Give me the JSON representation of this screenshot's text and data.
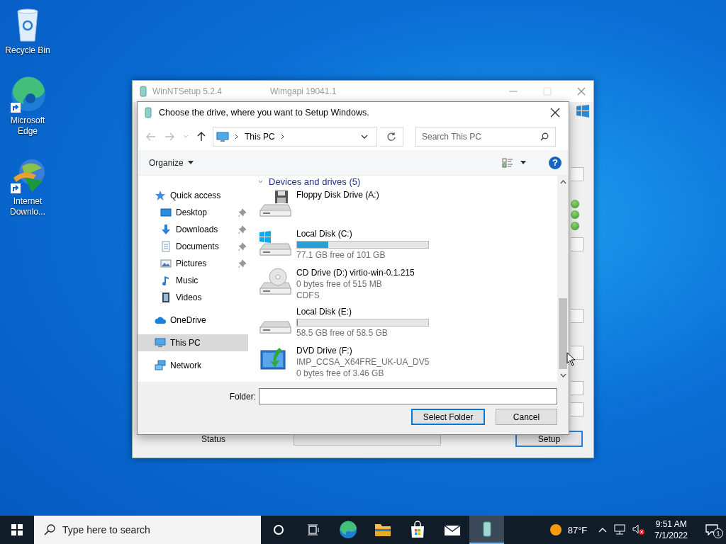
{
  "desktop_icons": [
    {
      "label": "Recycle Bin",
      "kind": "recycle"
    },
    {
      "label": "Microsoft Edge",
      "kind": "edge"
    },
    {
      "label": "Internet Downlo...",
      "kind": "idm"
    }
  ],
  "background_window": {
    "title": "WinNTSetup 5.2.4",
    "subtitle": "Wimgapi 19041.1",
    "status_label": "Status",
    "setup_button": "Setup"
  },
  "dialog": {
    "title": "Choose the drive, where you want to Setup Windows.",
    "nav_buttons": [
      {
        "kind": "back",
        "disabled": true
      },
      {
        "kind": "forward",
        "disabled": true
      },
      {
        "kind": "recent",
        "disabled": true
      },
      {
        "kind": "up",
        "disabled": false
      }
    ],
    "breadcrumb": [
      "This PC"
    ],
    "search": {
      "placeholder": "Search This PC"
    },
    "organize": "Organize",
    "help": "?",
    "nav": [
      {
        "label": "Quick access",
        "kind": "star",
        "selected": false,
        "children": [
          {
            "label": "Desktop",
            "kind": "desktop",
            "pinned": true
          },
          {
            "label": "Downloads",
            "kind": "downloads",
            "pinned": true
          },
          {
            "label": "Documents",
            "kind": "documents",
            "pinned": true
          },
          {
            "label": "Pictures",
            "kind": "pictures",
            "pinned": true
          },
          {
            "label": "Music",
            "kind": "music",
            "pinned": false
          },
          {
            "label": "Videos",
            "kind": "videos",
            "pinned": false
          }
        ]
      },
      {
        "label": "OneDrive",
        "kind": "cloud",
        "selected": false
      },
      {
        "label": "This PC",
        "kind": "pc",
        "selected": true
      },
      {
        "label": "Network",
        "kind": "network",
        "selected": false
      }
    ],
    "section_header": "Devices and drives (5)",
    "drives": [
      {
        "name": "Floppy Disk Drive (A:)",
        "kind": "floppy"
      },
      {
        "name": "Local Disk (C:)",
        "kind": "system",
        "level": 0.24,
        "details": [
          "77.1 GB free of 101 GB"
        ]
      },
      {
        "name": "CD Drive (D:) virtio-win-0.1.215",
        "kind": "cd",
        "details": [
          "0 bytes free of 515 MB",
          "CDFS"
        ]
      },
      {
        "name": "Local Disk (E:)",
        "kind": "disk",
        "level": 0,
        "details": [
          "58.5 GB free of 58.5 GB"
        ]
      },
      {
        "name": "DVD Drive (F:)",
        "kind": "dvd",
        "details": [
          "IMP_CCSA_X64FRE_UK-UA_DV5",
          "0 bytes free of 3.46 GB"
        ]
      }
    ],
    "folder_label": "Folder:",
    "buttons": [
      {
        "label": "Select Folder",
        "selected": true
      },
      {
        "label": "Cancel",
        "selected": false
      }
    ]
  },
  "taskbar": {
    "search": {
      "placeholder": "Type here to search"
    },
    "apps": [
      {
        "kind": "edge",
        "active": false
      },
      {
        "kind": "folder",
        "active": false
      },
      {
        "kind": "store",
        "active": false
      },
      {
        "kind": "mail",
        "active": false
      },
      {
        "kind": "setup",
        "active": true
      }
    ],
    "temperature": "87°F",
    "time": "9:51 AM",
    "date": "7/1/2022",
    "notifications": "1"
  }
}
